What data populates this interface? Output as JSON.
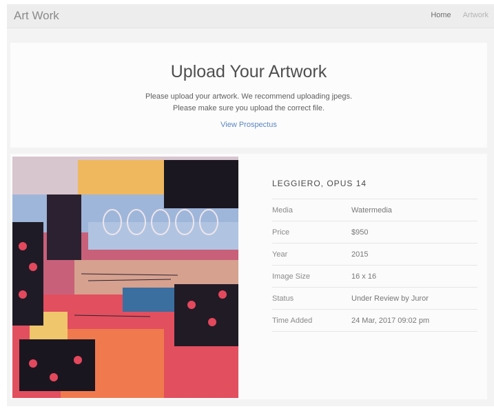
{
  "navbar": {
    "brand": "Art Work",
    "links": [
      "Home",
      "Artwork"
    ]
  },
  "hero": {
    "title": "Upload Your Artwork",
    "line1": "Please upload your artwork. We recommend uploading jpegs.",
    "line2": "Please make sure you upload the correct file.",
    "link": "View Prospectus"
  },
  "artwork": {
    "title": "LEGGIERO, OPUS 14",
    "details": [
      {
        "label": "Media",
        "value": "Watermedia"
      },
      {
        "label": "Price",
        "value": "$950"
      },
      {
        "label": "Year",
        "value": "2015"
      },
      {
        "label": "Image Size",
        "value": "16 x 16"
      },
      {
        "label": "Status",
        "value": "Under Review by Juror"
      },
      {
        "label": "Time Added",
        "value": "24 Mar, 2017 09:02 pm"
      }
    ]
  },
  "colors": {
    "link": "#5a86c2",
    "page_bg": "#f3f3f4"
  }
}
